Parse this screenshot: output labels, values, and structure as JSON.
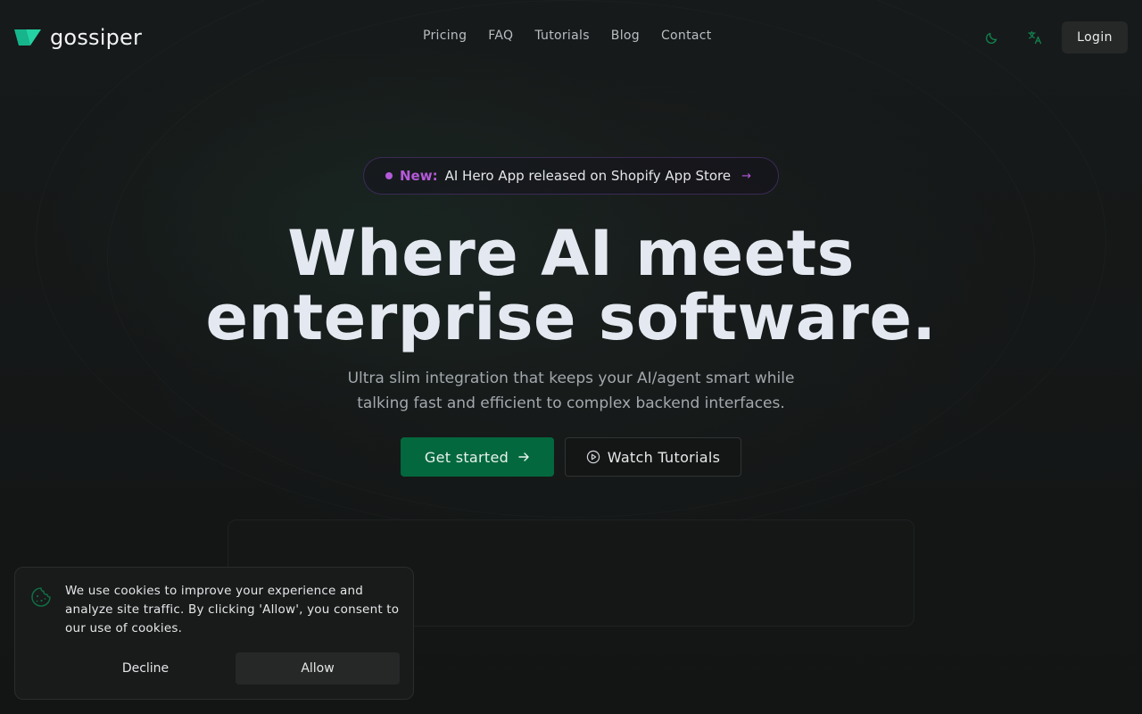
{
  "brand": {
    "name": "gossiper",
    "logo_icon": "gossiper-logo-icon",
    "accent": "#1fc99a"
  },
  "nav": {
    "items": [
      {
        "label": "Pricing"
      },
      {
        "label": "FAQ"
      },
      {
        "label": "Tutorials"
      },
      {
        "label": "Blog"
      },
      {
        "label": "Contact"
      }
    ]
  },
  "header_actions": {
    "theme_icon": "moon-icon",
    "language_icon": "translate-icon",
    "login_label": "Login"
  },
  "hero": {
    "badge": {
      "new_label": "New:",
      "text": "AI Hero App released on Shopify App Store",
      "arrow": "→",
      "accent": "#b45ad8"
    },
    "headline_line1": "Where AI meets",
    "headline_line2": "enterprise software.",
    "subtitle_line1": "Ultra slim integration that keeps your AI/agent smart while",
    "subtitle_line2": "talking fast and efficient to complex backend interfaces.",
    "primary_cta": {
      "label": "Get started",
      "icon": "arrow-right-icon",
      "color": "#04683e"
    },
    "secondary_cta": {
      "label": "Watch Tutorials",
      "icon": "play-circle-icon"
    }
  },
  "cookie_banner": {
    "icon": "cookie-icon",
    "text": "We use cookies to improve your experience and analyze site traffic. By clicking 'Allow', you consent to our use of cookies.",
    "decline_label": "Decline",
    "allow_label": "Allow"
  }
}
